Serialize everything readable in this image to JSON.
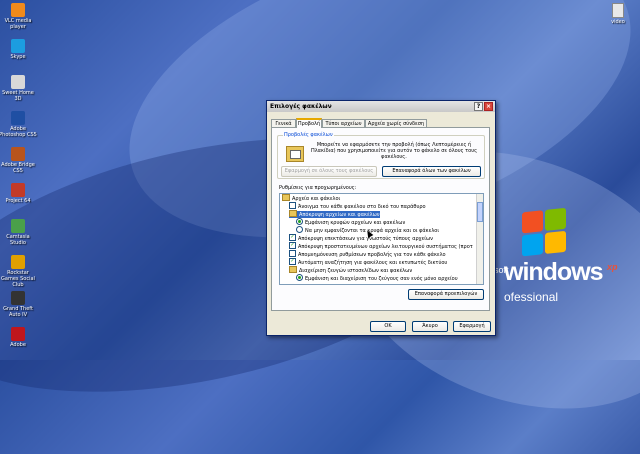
{
  "desktop": {
    "icons_left": [
      {
        "label": "VLC media player",
        "color": "#f08a1c"
      },
      {
        "label": "Skype",
        "color": "#1c9de0"
      },
      {
        "label": "Sweet Home 3D",
        "color": "#d8d8d8"
      },
      {
        "label": "Adobe Photoshop CS5",
        "color": "#1f4fa3"
      },
      {
        "label": "Adobe Bridge CS5",
        "color": "#b8541c"
      },
      {
        "label": "Project 64",
        "color": "#c23a28"
      },
      {
        "label": "Camtasia Studio",
        "color": "#4aa04a"
      },
      {
        "label": "Rockstar Games Social Club",
        "color": "#e0a000"
      },
      {
        "label": "Grand Theft Auto IV",
        "color": "#333333"
      },
      {
        "label": "Adobe",
        "color": "#c0161c"
      }
    ],
    "icon_right": {
      "label": "video",
      "color": "#e8e8e8"
    },
    "logo": {
      "soft": "soft",
      "windows": "windows",
      "xp": "xp",
      "edition": "ofessional"
    }
  },
  "dialog": {
    "title": "Επιλογές φακέλων",
    "help_btn": "?",
    "close_btn": "×",
    "tabs": [
      "Γενικά",
      "Προβολή",
      "Τύποι αρχείων",
      "Αρχεία χωρίς σύνδεση"
    ],
    "active_tab": 1,
    "folder_views": {
      "title": "Προβολές φακέλων",
      "description": "Μπορείτε να εφαρμόσετε την προβολή (όπως Λεπτομέρειες ή Πλακίδια) που χρησιμοποιείτε για αυτόν το φάκελο σε όλους τους φακέλους.",
      "apply_all": "Εφαρμογή σε όλους τους φακέλους",
      "reset_all": "Επαναφορά όλων των φακέλων"
    },
    "advanced_label": "Ρυθμίσεις για προχωρημένους:",
    "tree_items": [
      {
        "type": "folder",
        "text": "Αρχεία και φάκελοι",
        "indent": 0,
        "checked": false,
        "selected": false
      },
      {
        "type": "check",
        "text": "Άνοιγμα του κάθε φακέλου στο δικό του παράθυρο",
        "indent": 1,
        "checked": false,
        "selected": false
      },
      {
        "type": "folder",
        "text": "Απόκρυψη αρχείων και φακέλων",
        "indent": 1,
        "checked": false,
        "selected": true
      },
      {
        "type": "radio",
        "text": "Εμφάνιση κρυφών αρχείων και φακέλων",
        "indent": 2,
        "checked": true,
        "selected": false
      },
      {
        "type": "radio",
        "text": "Να μην εμφανίζονται τα κρυφά αρχεία και οι φάκελοι",
        "indent": 2,
        "checked": false,
        "selected": false
      },
      {
        "type": "check",
        "text": "Απόκρυψη επεκτάσεων για γνωστούς τύπους αρχείων",
        "indent": 1,
        "checked": true,
        "selected": false
      },
      {
        "type": "check",
        "text": "Απόκρυψη προστατευμένων αρχείων λειτουργικού συστήματος (προτ",
        "indent": 1,
        "checked": true,
        "selected": false
      },
      {
        "type": "check",
        "text": "Απομνημόνευση ρυθμίσεων προβολής για τον κάθε φάκελο",
        "indent": 1,
        "checked": false,
        "selected": false
      },
      {
        "type": "check",
        "text": "Αυτόματη αναζήτηση για φακέλους και εκτυπωτές δικτύου",
        "indent": 1,
        "checked": true,
        "selected": false
      },
      {
        "type": "folder",
        "text": "Διαχείριση ζευγών ιστοσελίδων και φακέλων",
        "indent": 1,
        "checked": false,
        "selected": false
      },
      {
        "type": "radio",
        "text": "Εμφάνιση και διαχείριση του ζεύγους σαν ενός μόνο αρχείου",
        "indent": 2,
        "checked": true,
        "selected": false
      }
    ],
    "restore_defaults": "Επαναφορά προεπιλογών",
    "ok": "OK",
    "cancel": "Άκυρο",
    "apply": "Εφαρμογή"
  }
}
